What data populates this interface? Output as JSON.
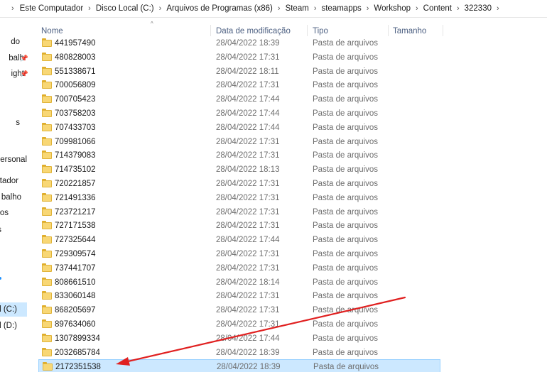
{
  "breadcrumb": {
    "items": [
      "Este Computador",
      "Disco Local (C:)",
      "Arquivos de Programas (x86)",
      "Steam",
      "steamapps",
      "Workshop",
      "Content",
      "322330"
    ]
  },
  "navpane": {
    "items": [
      {
        "label": "do",
        "pinned": false
      },
      {
        "label": "balh",
        "pinned": true
      },
      {
        "label": "ight",
        "pinned": true
      },
      {
        "label": "s",
        "pinned": false
      },
      {
        "label": "Personal",
        "pinned": false
      },
      {
        "label": "tador",
        "pinned": false
      },
      {
        "label": "balho",
        "pinned": false
      },
      {
        "label": "os",
        "pinned": false
      },
      {
        "label": "s",
        "pinned": false
      },
      {
        "label": "l (C:)",
        "pinned": false,
        "selected": true
      },
      {
        "label": "l (D:)",
        "pinned": false
      }
    ]
  },
  "columns": {
    "name": "Nome",
    "date": "Data de modificação",
    "type": "Tipo",
    "size": "Tamanho"
  },
  "files": [
    {
      "name": "441957490",
      "date": "28/04/2022 18:39",
      "type": "Pasta de arquivos"
    },
    {
      "name": "480828003",
      "date": "28/04/2022 17:31",
      "type": "Pasta de arquivos"
    },
    {
      "name": "551338671",
      "date": "28/04/2022 18:11",
      "type": "Pasta de arquivos"
    },
    {
      "name": "700056809",
      "date": "28/04/2022 17:31",
      "type": "Pasta de arquivos"
    },
    {
      "name": "700705423",
      "date": "28/04/2022 17:44",
      "type": "Pasta de arquivos"
    },
    {
      "name": "703758203",
      "date": "28/04/2022 17:44",
      "type": "Pasta de arquivos"
    },
    {
      "name": "707433703",
      "date": "28/04/2022 17:44",
      "type": "Pasta de arquivos"
    },
    {
      "name": "709981066",
      "date": "28/04/2022 17:31",
      "type": "Pasta de arquivos"
    },
    {
      "name": "714379083",
      "date": "28/04/2022 17:31",
      "type": "Pasta de arquivos"
    },
    {
      "name": "714735102",
      "date": "28/04/2022 18:13",
      "type": "Pasta de arquivos"
    },
    {
      "name": "720221857",
      "date": "28/04/2022 17:31",
      "type": "Pasta de arquivos"
    },
    {
      "name": "721491336",
      "date": "28/04/2022 17:31",
      "type": "Pasta de arquivos"
    },
    {
      "name": "723721217",
      "date": "28/04/2022 17:31",
      "type": "Pasta de arquivos"
    },
    {
      "name": "727171538",
      "date": "28/04/2022 17:31",
      "type": "Pasta de arquivos"
    },
    {
      "name": "727325644",
      "date": "28/04/2022 17:44",
      "type": "Pasta de arquivos"
    },
    {
      "name": "729309574",
      "date": "28/04/2022 17:31",
      "type": "Pasta de arquivos"
    },
    {
      "name": "737441707",
      "date": "28/04/2022 17:31",
      "type": "Pasta de arquivos"
    },
    {
      "name": "808661510",
      "date": "28/04/2022 18:14",
      "type": "Pasta de arquivos"
    },
    {
      "name": "833060148",
      "date": "28/04/2022 17:31",
      "type": "Pasta de arquivos"
    },
    {
      "name": "868205697",
      "date": "28/04/2022 17:31",
      "type": "Pasta de arquivos"
    },
    {
      "name": "897634060",
      "date": "28/04/2022 17:31",
      "type": "Pasta de arquivos"
    },
    {
      "name": "1307899334",
      "date": "28/04/2022 17:44",
      "type": "Pasta de arquivos"
    },
    {
      "name": "2032685784",
      "date": "28/04/2022 18:39",
      "type": "Pasta de arquivos"
    },
    {
      "name": "2172351538",
      "date": "28/04/2022 18:39",
      "type": "Pasta de arquivos",
      "selected": true
    }
  ],
  "colors": {
    "selection_bg": "#cce8ff",
    "selection_border": "#99d1ff",
    "folder": "#f8d775",
    "annotation_arrow": "#e02020"
  }
}
